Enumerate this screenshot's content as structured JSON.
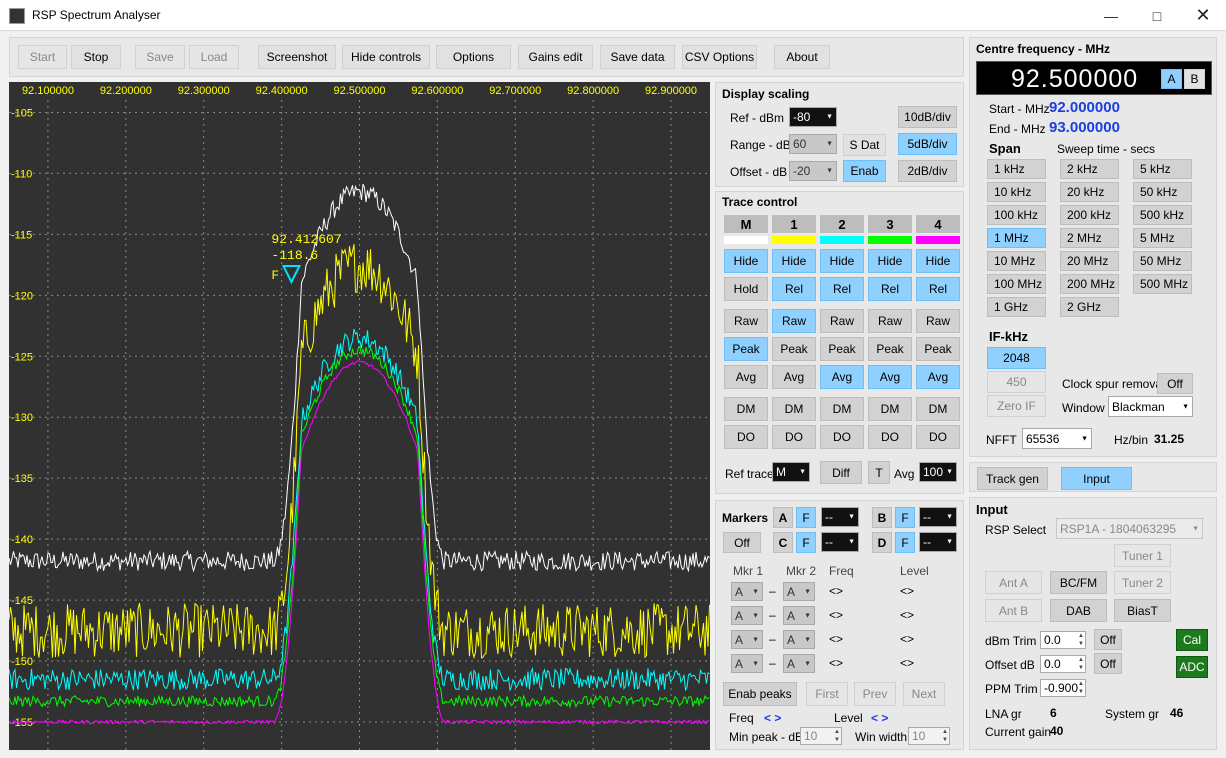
{
  "window": {
    "title": "RSP Spectrum Analyser"
  },
  "toolbar": {
    "start": "Start",
    "stop": "Stop",
    "save": "Save",
    "load": "Load",
    "screenshot": "Screenshot",
    "hide_controls": "Hide controls",
    "options": "Options",
    "gains_edit": "Gains edit",
    "save_data": "Save data",
    "csv_options": "CSV Options",
    "about": "About"
  },
  "plot": {
    "freq_ticks": [
      "92.100000",
      "92.200000",
      "92.300000",
      "92.400000",
      "92.500000",
      "92.600000",
      "92.700000",
      "92.800000",
      "92.900000"
    ],
    "level_ticks": [
      "-105",
      "-110",
      "-115",
      "-120",
      "-125",
      "-130",
      "-135",
      "-140",
      "-145",
      "-150",
      "-155"
    ],
    "marker_freq": "92.412607",
    "marker_level": "-118.6",
    "marker_tag": "F",
    "colors": {
      "bg": "#313131",
      "M": "#ffffff",
      "1": "#ffff00",
      "2": "#00ffff",
      "3": "#00ff00",
      "4": "#ff00ff",
      "ticks": "#ffff00"
    }
  },
  "display_scaling": {
    "title": "Display scaling",
    "ref_label": "Ref - dBm",
    "ref_value": "-80",
    "range_label": "Range - dB",
    "range_value": "60",
    "offset_label": "Offset - dB",
    "offset_value": "-20",
    "sdat": "S Dat",
    "enab": "Enab",
    "div10": "10dB/div",
    "div5": "5dB/div",
    "div2": "2dB/div"
  },
  "trace_control": {
    "title": "Trace control",
    "headers": [
      "M",
      "1",
      "2",
      "3",
      "4"
    ],
    "hide": "Hide",
    "hold": "Hold",
    "rel": "Rel",
    "raw": "Raw",
    "peak": "Peak",
    "avg": "Avg",
    "dm": "DM",
    "do": "DO",
    "ref_trace_label": "Ref trace",
    "ref_trace_value": "M",
    "diff": "Diff",
    "t": "T",
    "avg_label": "Avg",
    "avg_value": "100"
  },
  "markers": {
    "title": "Markers",
    "a": "A",
    "b": "B",
    "c": "C",
    "d": "D",
    "f": "F",
    "off": "Off",
    "sel_value": "--",
    "mkr1": "Mkr 1",
    "mkr2": "Mkr 2",
    "freq": "Freq",
    "level": "Level",
    "row_sel": "A",
    "dash": "–",
    "arrows": "<>",
    "enab_peaks": "Enab peaks",
    "first": "First",
    "prev": "Prev",
    "next": "Next",
    "freq_label": "Freq",
    "level_label": "Level",
    "nav": "< >",
    "min_peak_label": "Min peak - dB",
    "min_peak_value": "10",
    "win_width_label": "Win width",
    "win_width_value": "10"
  },
  "centre": {
    "title": "Centre frequency - MHz",
    "value": "92.500000",
    "a": "A",
    "b": "B",
    "start_label": "Start - MHz",
    "start_value": "92.000000",
    "end_label": "End - MHz",
    "end_value": "93.000000",
    "span_label": "Span",
    "sweep_label": "Sweep time - secs",
    "spans": [
      "1 kHz",
      "2 kHz",
      "5 kHz",
      "10 kHz",
      "20 kHz",
      "50 kHz",
      "100 kHz",
      "200 kHz",
      "500 kHz",
      "1 MHz",
      "2 MHz",
      "5 MHz",
      "10 MHz",
      "20 MHz",
      "50 MHz",
      "100 MHz",
      "200 MHz",
      "500 MHz",
      "1 GHz",
      "2 GHz"
    ],
    "if_label": "IF-kHz",
    "if_2048": "2048",
    "if_450": "450",
    "zero_if": "Zero IF",
    "clock_spur_label": "Clock spur removal",
    "clock_spur_value": "Off",
    "window_label": "Window",
    "window_value": "Blackman",
    "nfft_label": "NFFT",
    "nfft_value": "65536",
    "hzbin_label": "Hz/bin",
    "hzbin_value": "31.25"
  },
  "tabs": {
    "track_gen": "Track gen",
    "input": "Input"
  },
  "input": {
    "title": "Input",
    "rsp_label": "RSP Select",
    "rsp_value": "RSP1A - 1804063295",
    "tuner1": "Tuner 1",
    "tuner2": "Tuner 2",
    "ant_a": "Ant A",
    "bcfm": "BC/FM",
    "ant_b": "Ant B",
    "dab": "DAB",
    "biast": "BiasT",
    "dbm_trim_label": "dBm Trim",
    "dbm_trim_value": "0.0",
    "off": "Off",
    "cal": "Cal",
    "offset_label": "Offset dB",
    "offset_value": "0.0",
    "adc": "ADC",
    "ppm_label": "PPM Trim",
    "ppm_value": "-0.900",
    "lna_label": "LNA gr",
    "lna_value": "6",
    "system_label": "System gr",
    "system_value": "46",
    "current_label": "Current gain",
    "current_value": "40"
  }
}
